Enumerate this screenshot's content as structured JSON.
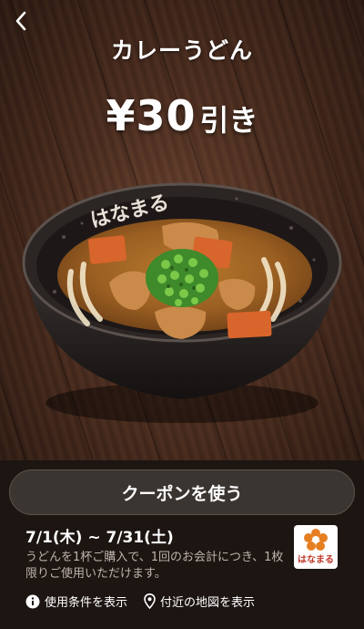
{
  "header": {
    "back_icon": "chevron-left-icon",
    "title": "カレーうどん"
  },
  "offer": {
    "amount": "¥30",
    "suffix": "引き"
  },
  "hero_image": {
    "bowl_logo": "はなまる"
  },
  "coupon": {
    "use_button": "クーポンを使う",
    "period": "7/1(木) ~ 7/31(土)",
    "description": "うどんを1杯ご購入で、1回のお会計につき、1枚限りご使用いただけます。",
    "brand_logo_text": "はなまる"
  },
  "links": {
    "terms": "使用条件を表示",
    "terms_icon": "info-icon",
    "map": "付近の地図を表示",
    "map_icon": "location-pin-icon"
  },
  "colors": {
    "panel_bg": "#1c1512",
    "button_bg": "#3b3531",
    "logo_red": "#c0392b"
  }
}
